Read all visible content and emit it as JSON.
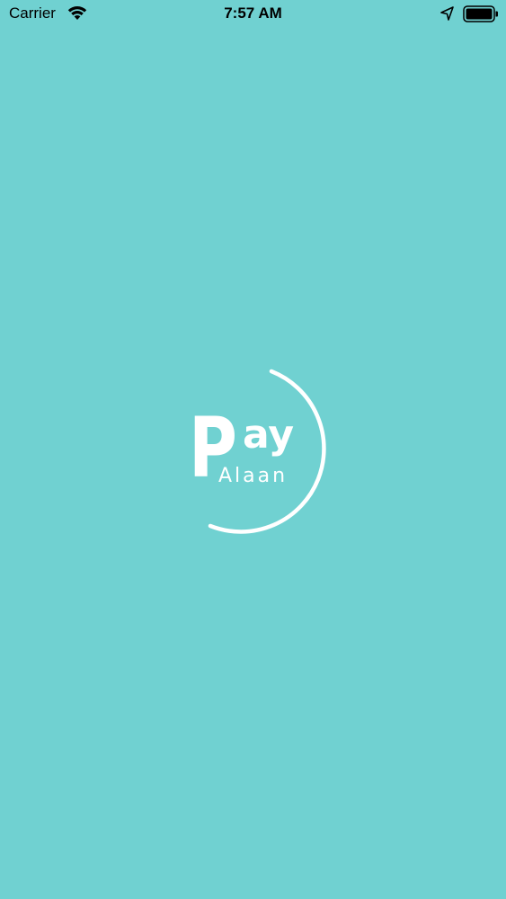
{
  "status_bar": {
    "carrier": "Carrier",
    "time": "7:57 AM",
    "icons": [
      "wifi-icon",
      "location-arrow-icon",
      "battery-icon"
    ]
  },
  "splash": {
    "logo": {
      "text_p": "P",
      "text_ay": "ay",
      "text_alaan": "Alaan"
    }
  },
  "colors": {
    "background": "#70D1D1",
    "logo": "#FFFFFF",
    "status_text": "#000000"
  }
}
